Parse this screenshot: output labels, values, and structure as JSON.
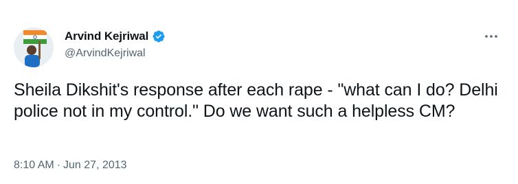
{
  "author": {
    "display_name": "Arvind Kejriwal",
    "handle": "@ArvindKejriwal",
    "verified": true,
    "verified_color": "#1d9bf0"
  },
  "tweet": {
    "text": "Sheila Dikshit's response after each rape - \"what can I do? Delhi police not in my control.\" Do we want such a helpless CM?",
    "time": "8:10 AM",
    "separator": "·",
    "date": "Jun 27, 2013"
  },
  "icons": {
    "more": "more-options-icon",
    "verified": "verified-badge-icon"
  },
  "colors": {
    "text_primary": "#0f1419",
    "text_secondary": "#536471",
    "background": "#ffffff"
  }
}
